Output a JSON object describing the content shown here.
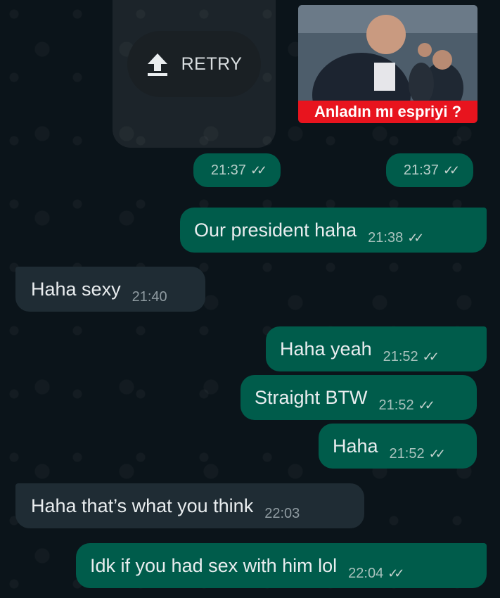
{
  "retry": {
    "label": "RETRY"
  },
  "image_message": {
    "caption": "Anladın mı espriyi ?",
    "time": "21:37"
  },
  "pending_message": {
    "time": "21:37"
  },
  "messages": [
    {
      "text": "Our president haha",
      "time": "21:38",
      "direction": "out"
    },
    {
      "text": "Haha sexy",
      "time": "21:40",
      "direction": "in"
    },
    {
      "text": "Haha yeah",
      "time": "21:52",
      "direction": "out"
    },
    {
      "text": "Straight BTW",
      "time": "21:52",
      "direction": "out"
    },
    {
      "text": "Haha",
      "time": "21:52",
      "direction": "out"
    },
    {
      "text": "Haha that’s what you think",
      "time": "22:03",
      "direction": "in"
    },
    {
      "text": "Idk if you had sex with him lol",
      "time": "22:04",
      "direction": "out"
    }
  ],
  "colors": {
    "outgoing": "#005c4b",
    "incoming": "#1f2c34",
    "background": "#0b141a",
    "caption_bg": "#e8141e"
  }
}
